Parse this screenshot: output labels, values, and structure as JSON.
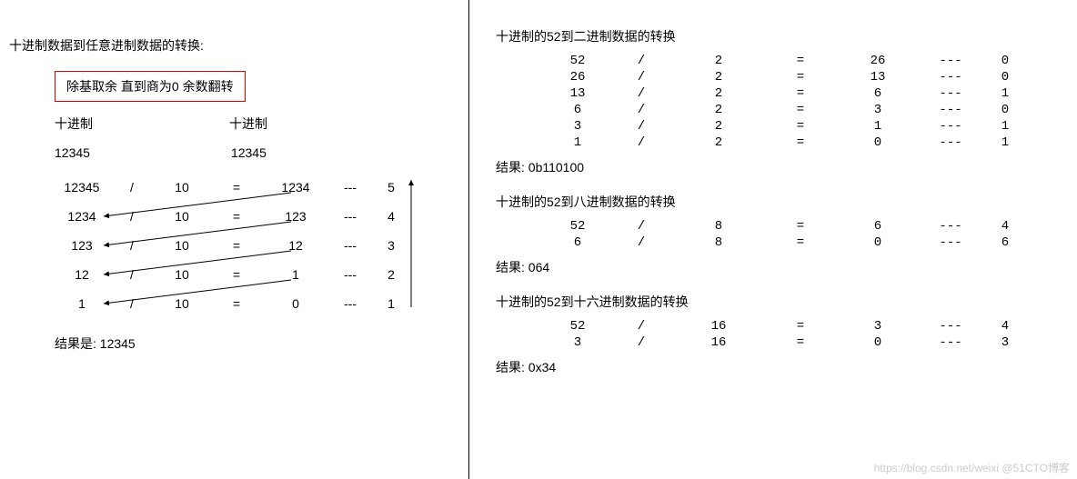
{
  "left": {
    "title": "十进制数据到任意进制数据的转换:",
    "rule": "除基取余   直到商为0  余数翻转",
    "col_hdr_left": "十进制",
    "col_hdr_right": "十进制",
    "value_left": "12345",
    "value_right": "12345",
    "rows": [
      {
        "n": "12345",
        "op": "/",
        "b": "10",
        "eq": "=",
        "q": "1234",
        "d": "---",
        "r": "5"
      },
      {
        "n": "1234",
        "op": "/",
        "b": "10",
        "eq": "=",
        "q": "123",
        "d": "---",
        "r": "4"
      },
      {
        "n": "123",
        "op": "/",
        "b": "10",
        "eq": "=",
        "q": "12",
        "d": "---",
        "r": "3"
      },
      {
        "n": "12",
        "op": "/",
        "b": "10",
        "eq": "=",
        "q": "1",
        "d": "---",
        "r": "2"
      },
      {
        "n": "1",
        "op": "/",
        "b": "10",
        "eq": "=",
        "q": "0",
        "d": "---",
        "r": "1"
      }
    ],
    "result": "结果是: 12345"
  },
  "right": {
    "sec1": {
      "title": "十进制的52到二进制数据的转换",
      "rows": [
        {
          "n": "52",
          "op": "/",
          "b": "2",
          "eq": "=",
          "q": "26",
          "d": "---",
          "r": "0"
        },
        {
          "n": "26",
          "op": "/",
          "b": "2",
          "eq": "=",
          "q": "13",
          "d": "---",
          "r": "0"
        },
        {
          "n": "13",
          "op": "/",
          "b": "2",
          "eq": "=",
          "q": "6",
          "d": "---",
          "r": "1"
        },
        {
          "n": "6",
          "op": "/",
          "b": "2",
          "eq": "=",
          "q": "3",
          "d": "---",
          "r": "0"
        },
        {
          "n": "3",
          "op": "/",
          "b": "2",
          "eq": "=",
          "q": "1",
          "d": "---",
          "r": "1"
        },
        {
          "n": "1",
          "op": "/",
          "b": "2",
          "eq": "=",
          "q": "0",
          "d": "---",
          "r": "1"
        }
      ],
      "result": "结果: 0b110100"
    },
    "sec2": {
      "title": "十进制的52到八进制数据的转换",
      "rows": [
        {
          "n": "52",
          "op": "/",
          "b": "8",
          "eq": "=",
          "q": "6",
          "d": "---",
          "r": "4"
        },
        {
          "n": "6",
          "op": "/",
          "b": "8",
          "eq": "=",
          "q": "0",
          "d": "---",
          "r": "6"
        }
      ],
      "result": "结果: 064"
    },
    "sec3": {
      "title": "十进制的52到十六进制数据的转换",
      "rows": [
        {
          "n": "52",
          "op": "/",
          "b": "16",
          "eq": "=",
          "q": "3",
          "d": "---",
          "r": "4"
        },
        {
          "n": "3",
          "op": "/",
          "b": "16",
          "eq": "=",
          "q": "0",
          "d": "---",
          "r": "3"
        }
      ],
      "result": "结果: 0x34"
    }
  },
  "watermark": "https://blog.csdn.net/weixi @51CTO博客"
}
